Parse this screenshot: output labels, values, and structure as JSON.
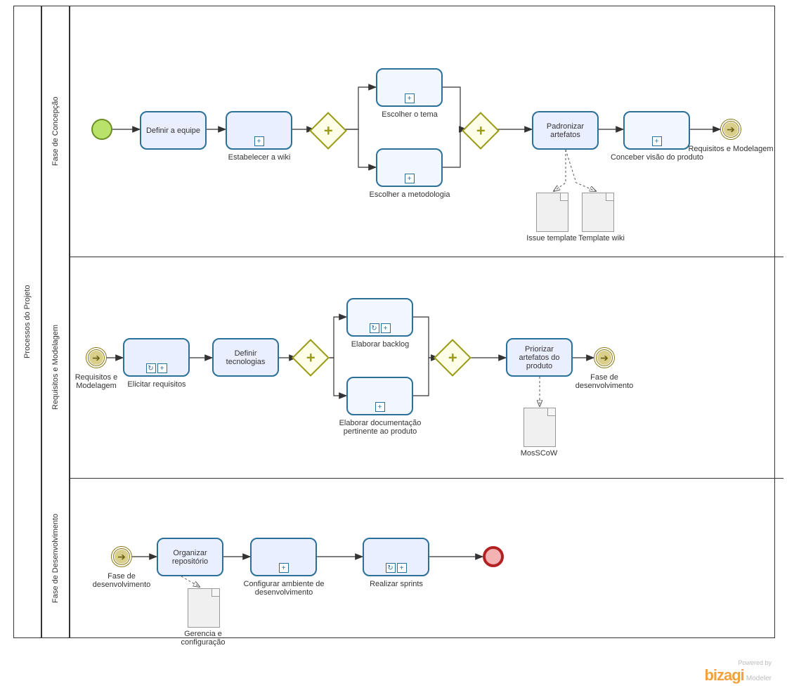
{
  "pool": {
    "title": "Processos do Projeto"
  },
  "lanes": {
    "l1": {
      "title": "Fase de Concepção"
    },
    "l2": {
      "title": "Requisitos e Modelagem"
    },
    "l3": {
      "title": "Fase de Desenvolvimento"
    }
  },
  "tasks": {
    "definir_equipe": "Definir a equipe",
    "estabelecer_wiki": "Estabelecer  a wiki",
    "escolher_tema": "Escolher o tema",
    "escolher_metodologia": "Escolher a metodologia",
    "padronizar_artefatos": "Padronizar artefatos",
    "conceber_visao": "Conceber visão do produto",
    "elicitar_requisitos": "Elicitar requisitos",
    "definir_tecnologias": "Definir tecnologias",
    "elaborar_backlog": "Elaborar backlog",
    "elaborar_doc": "Elaborar documentação pertinente ao produto",
    "priorizar_artefatos": "Priorizar artefatos do produto",
    "organizar_repo": "Organizar repositório",
    "configurar_ambiente": "Configurar ambiente de desenvolvimento",
    "realizar_sprints": "Realizar sprints"
  },
  "events": {
    "link_out_1": "Requisitos e Modelagem",
    "link_in_2": "Requisitos e Modelagem",
    "link_out_2": "Fase de desenvolvimento",
    "link_in_3": "Fase de desenvolvimento"
  },
  "artifacts": {
    "issue_template": "Issue template",
    "template_wiki": "Template wiki",
    "moscow": "MosSCoW",
    "gerencia": "Gerencia e configuração"
  },
  "branding": {
    "powered": "Powered by",
    "name": "bizagi",
    "product": "Modeler"
  },
  "markers": {
    "plus": "+",
    "loop": "↻"
  }
}
